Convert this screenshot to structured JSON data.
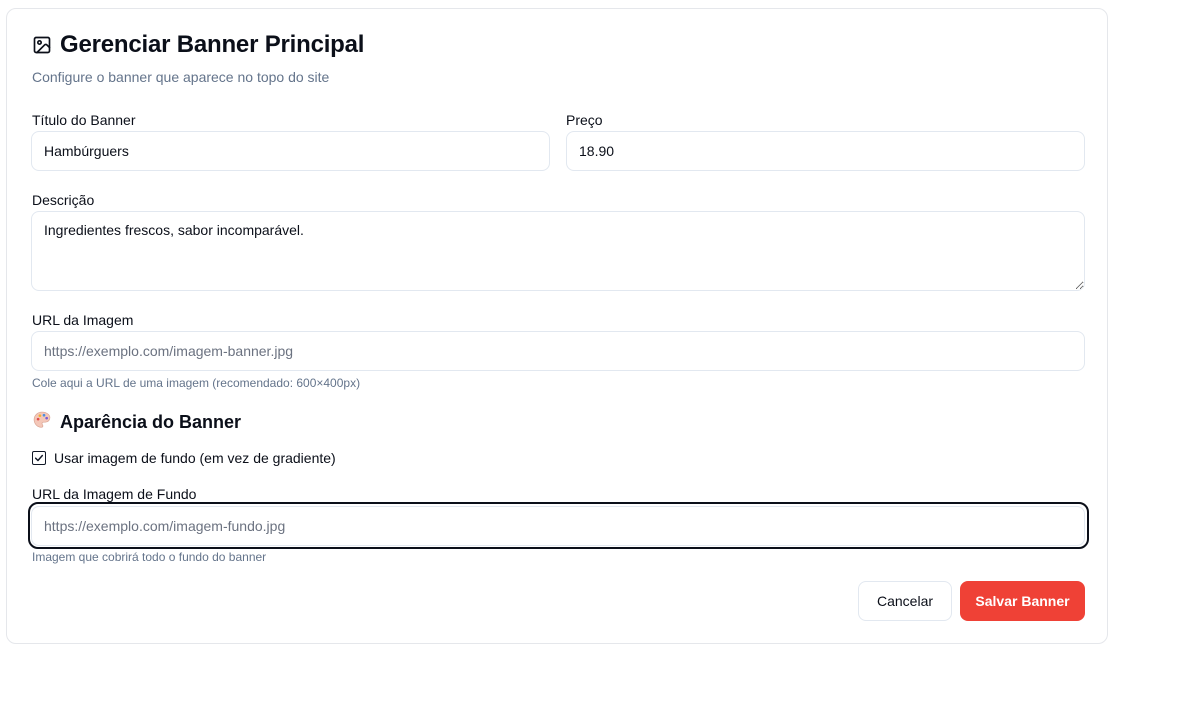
{
  "header": {
    "title": "Gerenciar Banner Principal",
    "subtitle": "Configure o banner que aparece no topo do site",
    "icon": "image-icon"
  },
  "form": {
    "title_label": "Título do Banner",
    "title_value": "Hambúrguers",
    "price_label": "Preço",
    "price_value": "18.90",
    "description_label": "Descrição",
    "description_value": "Ingredientes frescos, sabor incomparável.",
    "image_url_label": "URL da Imagem",
    "image_url_placeholder": "https://exemplo.com/imagem-banner.jpg",
    "image_url_value": "",
    "image_url_helper": "Cole aqui a URL de uma imagem (recomendado: 600×400px)"
  },
  "appearance": {
    "section_title": "Aparência do Banner",
    "section_icon": "palette-icon",
    "use_bg_image_label": "Usar imagem de fundo (em vez de gradiente)",
    "use_bg_image_checked": true,
    "bg_url_label": "URL da Imagem de Fundo",
    "bg_url_placeholder": "https://exemplo.com/imagem-fundo.jpg",
    "bg_url_value": "",
    "bg_url_helper": "Imagem que cobrirá todo o fundo do banner"
  },
  "actions": {
    "cancel_label": "Cancelar",
    "save_label": "Salvar Banner"
  },
  "colors": {
    "primary": "#ef4136",
    "border": "#e2e8f0",
    "muted_text": "#64748b"
  }
}
